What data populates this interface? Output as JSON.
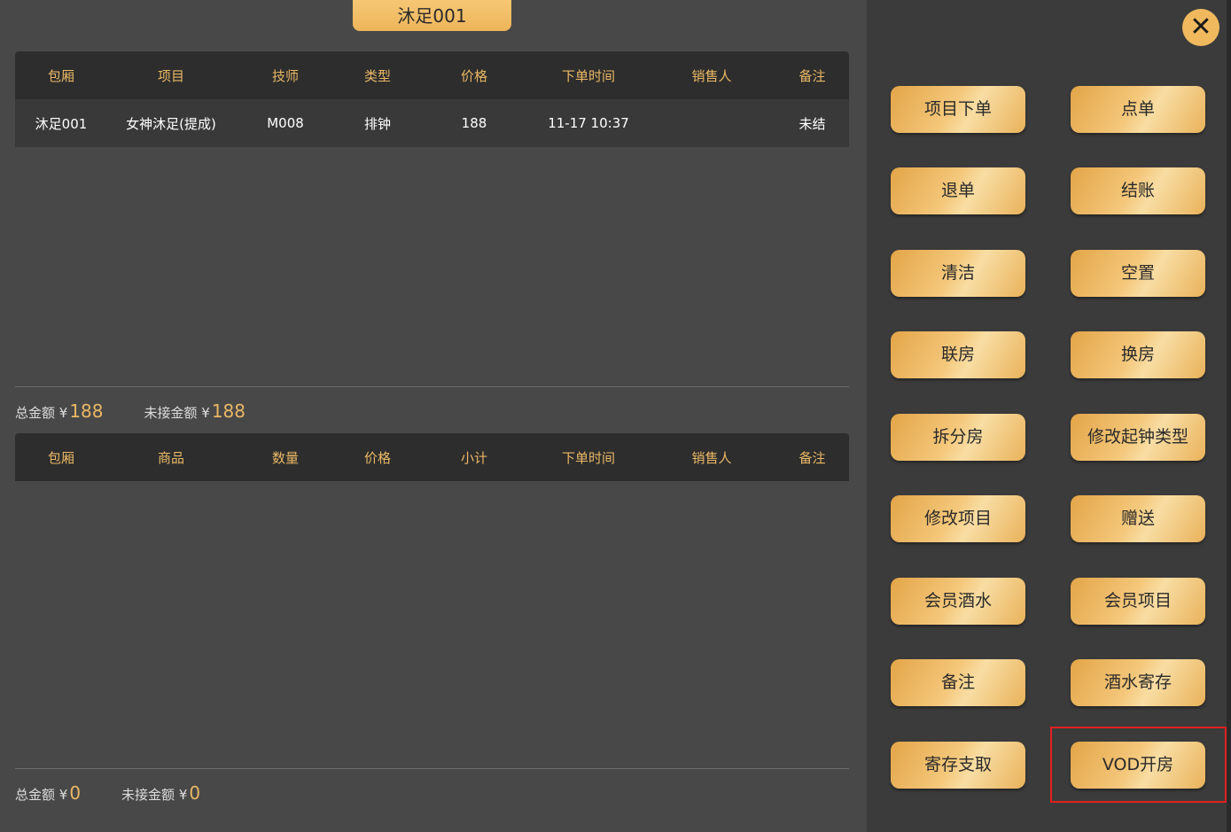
{
  "room_tab": "沐足001",
  "items_table": {
    "headers": [
      "包厢",
      "项目",
      "技师",
      "类型",
      "价格",
      "下单时间",
      "销售人",
      "备注"
    ],
    "rows": [
      [
        "沐足001",
        "女神沐足(提成)",
        "M008",
        "排钟",
        "188",
        "11-17 10:37",
        "",
        "未结"
      ]
    ]
  },
  "items_total": {
    "total_label": "总金额 ¥",
    "total_value": "188",
    "unpaid_label": "未接金额 ¥",
    "unpaid_value": "188"
  },
  "goods_table": {
    "headers": [
      "包厢",
      "商品",
      "数量",
      "价格",
      "小计",
      "下单时间",
      "销售人",
      "备注"
    ],
    "rows": []
  },
  "goods_total": {
    "total_label": "总金额 ¥",
    "total_value": "0",
    "unpaid_label": "未接金额 ¥",
    "unpaid_value": "0"
  },
  "close_icon": "close-icon",
  "buttons": [
    "项目下单",
    "点单",
    "退单",
    "结账",
    "清洁",
    "空置",
    "联房",
    "换房",
    "拆分房",
    "修改起钟类型",
    "修改项目",
    "赠送",
    "会员酒水",
    "会员项目",
    "备注",
    "酒水寄存",
    "寄存支取",
    "VOD开房"
  ],
  "colors": {
    "accent": "#eab865",
    "button_gold": "#f4c77a",
    "highlight": "#e02020"
  }
}
